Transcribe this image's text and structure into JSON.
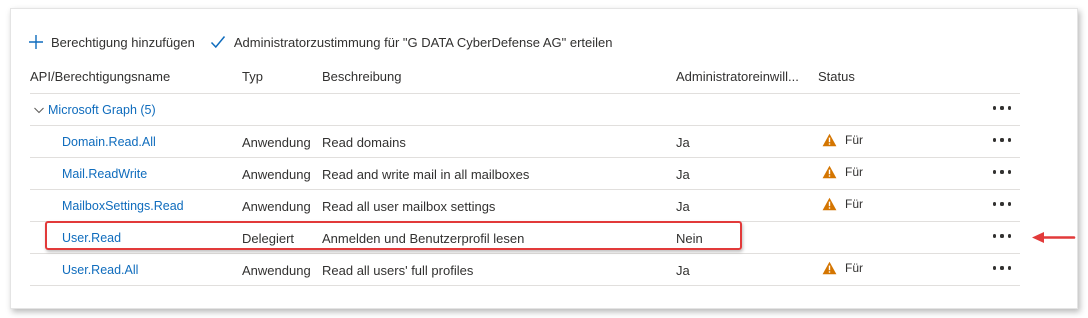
{
  "toolbar": {
    "add_label": "Berechtigung hinzufügen",
    "consent_label": "Administratorzustimmung für \"G DATA CyberDefense AG\" erteilen"
  },
  "columns": {
    "name": "API/Berechtigungsname",
    "type": "Typ",
    "description": "Beschreibung",
    "admin": "Administratoreinwill...",
    "status": "Status"
  },
  "group": {
    "label": "Microsoft Graph (5)"
  },
  "rows": [
    {
      "name": "Domain.Read.All",
      "type": "Anwendung",
      "description": "Read domains",
      "admin": "Ja",
      "status": "Für"
    },
    {
      "name": "Mail.ReadWrite",
      "type": "Anwendung",
      "description": "Read and write mail in all mailboxes",
      "admin": "Ja",
      "status": "Für"
    },
    {
      "name": "MailboxSettings.Read",
      "type": "Anwendung",
      "description": "Read all user mailbox settings",
      "admin": "Ja",
      "status": "Für"
    },
    {
      "name": "User.Read",
      "type": "Delegiert",
      "description": "Anmelden und Benutzerprofil lesen",
      "admin": "Nein",
      "status": ""
    },
    {
      "name": "User.Read.All",
      "type": "Anwendung",
      "description": "Read all users' full profiles",
      "admin": "Ja",
      "status": "Für"
    }
  ],
  "colors": {
    "link": "#0f6cbd",
    "warning": "#d47500",
    "highlight": "#e23a3a"
  },
  "icons": {
    "add": "plus-icon",
    "consent": "checkmark-icon",
    "group_toggle": "chevron-down-icon",
    "status": "warning-icon",
    "more": "more-icon",
    "annotation": "arrow-left-icon"
  }
}
